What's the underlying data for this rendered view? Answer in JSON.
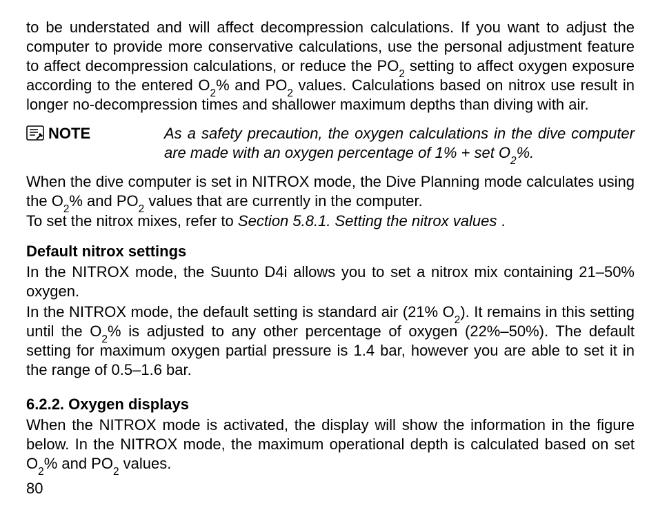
{
  "intro": {
    "p1_a": "to be understated and will affect decompression calculations. If you want to adjust the computer to provide more conservative calculations, use the personal adjustment feature to affect decompression calculations, or reduce the PO",
    "p1_b": " setting to affect oxygen exposure according to the entered O",
    "p1_c": "% and PO",
    "p1_d": " values. Calculations based on nitrox use result in longer no-decompression times and shallower maximum depths than diving with air."
  },
  "note": {
    "label": "NOTE",
    "icon": "note-icon",
    "body_a": "As a safety precaution, the oxygen calculations in the dive computer are made with an oxygen percentage of 1% + set O",
    "body_b": "%."
  },
  "after_note": {
    "p1_a": "When the dive computer is set in NITROX mode, the Dive Planning mode calculates using the O",
    "p1_b": "% and PO",
    "p1_c": " values that are currently in the computer.",
    "p2_a": "To set the nitrox mixes, refer to ",
    "p2_ref": "Section 5.8.1. Setting the nitrox values",
    "p2_b": " ."
  },
  "default_nitrox": {
    "heading": "Default nitrox settings",
    "p1": "In the NITROX mode, the Suunto D4i allows you to set a nitrox mix containing 21–50% oxygen.",
    "p2_a": "In the NITROX mode, the default setting is standard air (21% O",
    "p2_b": "). It remains in this setting until the O",
    "p2_c": "% is adjusted to any other percentage of oxygen (22%–50%). The default setting for maximum oxygen partial pressure is 1.4 bar, however you are able to set it in the range of 0.5–1.6 bar."
  },
  "oxygen_displays": {
    "heading": "6.2.2. Oxygen displays",
    "p1_a": "When the NITROX mode is activated, the display will show the information in the figure below. In the NITROX mode, the maximum operational depth is calculated based on set O",
    "p1_b": "% and PO",
    "p1_c": " values."
  },
  "sub2": "2",
  "page_number": "80"
}
